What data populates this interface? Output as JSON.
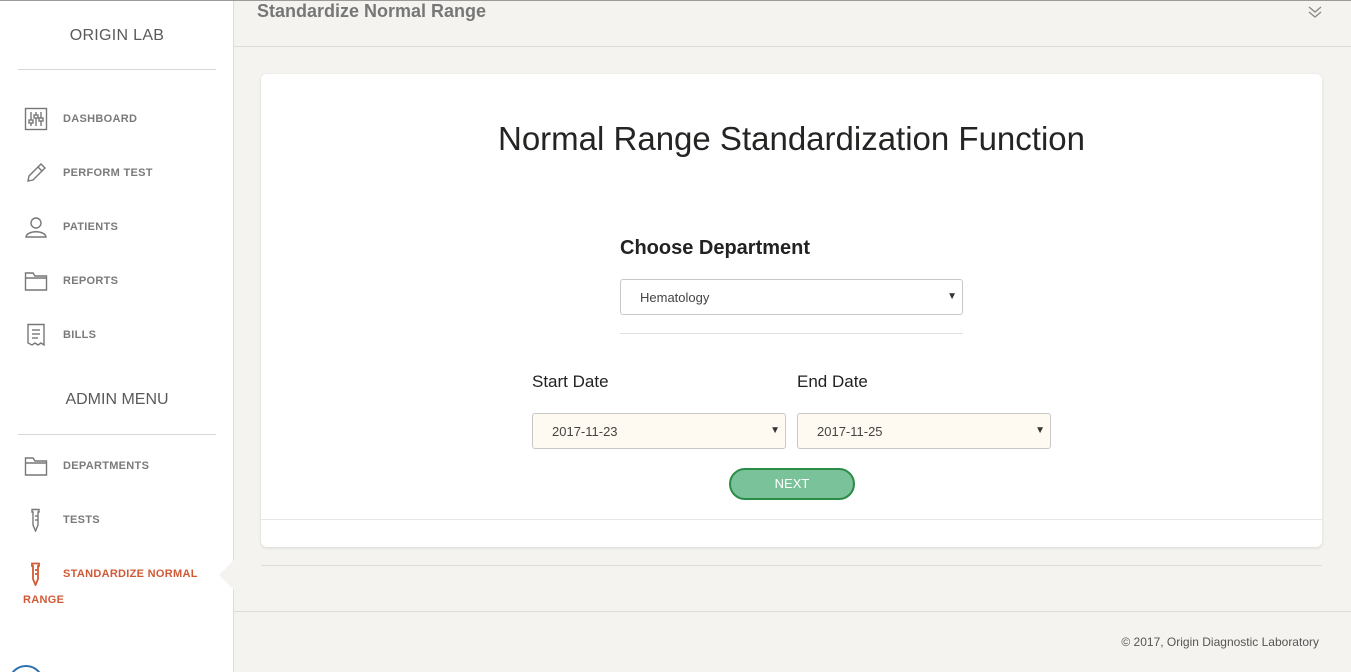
{
  "sidebar": {
    "brand": "ORIGIN LAB",
    "items": [
      {
        "label": "DASHBOARD",
        "icon": "sliders-icon"
      },
      {
        "label": "PERFORM TEST",
        "icon": "pen-icon"
      },
      {
        "label": "PATIENTS",
        "icon": "user-icon"
      },
      {
        "label": "REPORTS",
        "icon": "folder-icon"
      },
      {
        "label": "BILLS",
        "icon": "receipt-icon"
      }
    ],
    "admin_title": "ADMIN MENU",
    "admin_items": [
      {
        "label": "DEPARTMENTS",
        "icon": "folder-icon"
      },
      {
        "label": "TESTS",
        "icon": "pipette-icon"
      },
      {
        "label": "STANDARDIZE NORMAL",
        "label_line2": "RANGE",
        "icon": "pipette-icon",
        "active": true
      }
    ],
    "active_color": "#d05a36"
  },
  "header": {
    "title": "Standardize Normal Range"
  },
  "card": {
    "title": "Normal Range Standardization Function",
    "department": {
      "heading": "Choose Department",
      "selected": "Hematology"
    },
    "start_date": {
      "label": "Start Date",
      "selected": "2017-11-23"
    },
    "end_date": {
      "label": "End Date",
      "selected": "2017-11-25"
    },
    "next_label": "NEXT",
    "button_color": "#7ac29a"
  },
  "footer": {
    "copyright": "© 2017, Origin Diagnostic Laboratory"
  }
}
